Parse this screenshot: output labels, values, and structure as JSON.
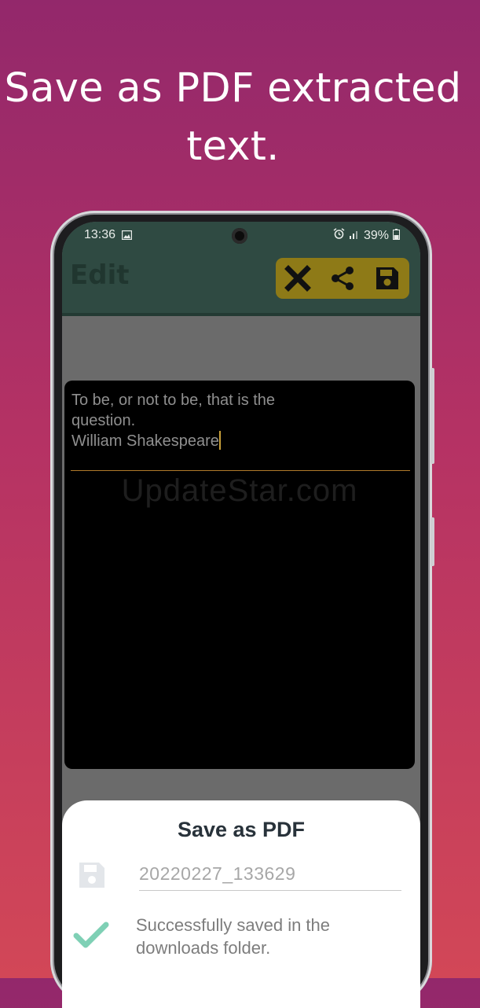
{
  "promo": {
    "title": "Save as PDF extracted text."
  },
  "status_bar": {
    "time": "13:36",
    "battery": "39%"
  },
  "app_bar": {
    "title": "Edit",
    "actions": [
      "close-icon",
      "share-icon",
      "save-icon"
    ]
  },
  "editor": {
    "text": "To be, or not to be, that is the\nquestion.\nWilliam Shakespeare",
    "watermark": "UpdateStar.com"
  },
  "save_dialog": {
    "title": "Save as PDF",
    "filename": "20220227_133629",
    "message": "Successfully saved in the downloads folder."
  },
  "colors": {
    "appbar": "#2f4a42",
    "action_group": "#8e7a17",
    "check": "#7fd0b5"
  }
}
